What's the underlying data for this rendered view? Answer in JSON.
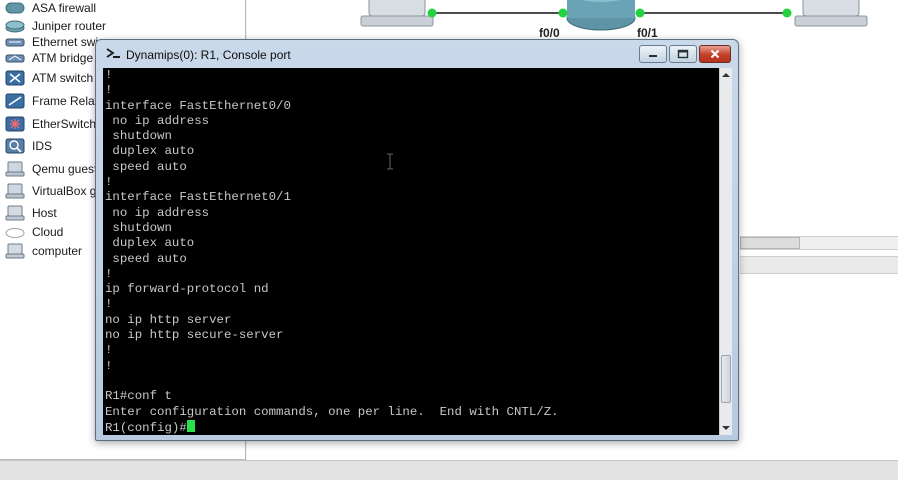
{
  "device_panel": {
    "items": [
      {
        "label": "ASA firewall",
        "icon": "firewall-icon"
      },
      {
        "label": "Juniper router",
        "icon": "router-icon"
      },
      {
        "label": "Ethernet swi",
        "icon": "ethernet-switch-icon"
      },
      {
        "label": "ATM bridge",
        "icon": "atm-bridge-icon"
      },
      {
        "label": "ATM switch",
        "icon": "atm-switch-icon"
      },
      {
        "label": "Frame Relay",
        "icon": "frame-relay-icon"
      },
      {
        "label": "EtherSwitch",
        "icon": "etherswitch-icon"
      },
      {
        "label": "IDS",
        "icon": "ids-icon"
      },
      {
        "label": "Qemu guest",
        "icon": "qemu-guest-icon"
      },
      {
        "label": "VirtualBox g",
        "icon": "virtualbox-icon"
      },
      {
        "label": "Host",
        "icon": "host-icon"
      },
      {
        "label": "Cloud",
        "icon": "cloud-icon"
      },
      {
        "label": "computer",
        "icon": "computer-icon"
      }
    ]
  },
  "topology": {
    "interfaces": [
      "f0/0",
      "f0/1"
    ],
    "link_up_color": "#22d33f"
  },
  "console_window": {
    "title": "Dynamips(0): R1, Console port",
    "lines": [
      "!",
      "!",
      "interface FastEthernet0/0",
      " no ip address",
      " shutdown",
      " duplex auto",
      " speed auto",
      "!",
      "interface FastEthernet0/1",
      " no ip address",
      " shutdown",
      " duplex auto",
      " speed auto",
      "!",
      "ip forward-protocol nd",
      "!",
      "no ip http server",
      "no ip http secure-server",
      "!",
      "!",
      "",
      "R1#conf t",
      "Enter configuration commands, one per line.  End with CNTL/Z."
    ],
    "prompt": "R1(config)#",
    "cursor_color": "#27e34a"
  }
}
